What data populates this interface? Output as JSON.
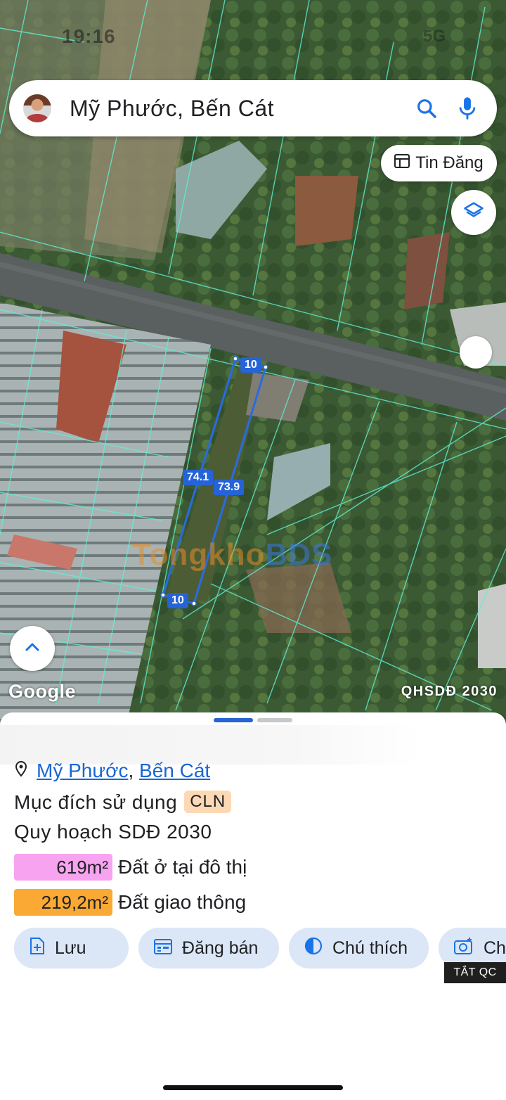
{
  "status_bar": {
    "time": "19:16",
    "right": "5G"
  },
  "search": {
    "query": "Mỹ Phước, Bến Cát"
  },
  "map_controls": {
    "tin_dang_label": "Tin Đăng"
  },
  "map": {
    "google_logo": "Google",
    "layer_label": "QHSDĐ 2030",
    "plot_dimensions": {
      "top": "10",
      "left": "74.1",
      "right": "73.9",
      "bottom": "10"
    },
    "watermark": {
      "part1": "Tongkho",
      "part2": "BDS"
    }
  },
  "details": {
    "location_parts": [
      "Mỹ Phước",
      "Bến Cát"
    ],
    "purpose_label": "Mục đích sử dụng",
    "purpose_code": "CLN",
    "plan_label": "Quy hoạch SDĐ 2030",
    "areas": [
      {
        "value": "619m²",
        "label": "Đất ở tại đô thị",
        "color": "#f7a3f0"
      },
      {
        "value": "219,2m²",
        "label": "Đất giao thông",
        "color": "#f9a934"
      }
    ]
  },
  "actions": [
    {
      "label": "Lưu",
      "icon": "save-icon"
    },
    {
      "label": "Đăng bán",
      "icon": "calendar-icon"
    },
    {
      "label": "Chú thích",
      "icon": "contrast-icon"
    },
    {
      "label": "Ch",
      "icon": "camera-icon"
    }
  ],
  "ad_label": "TẮT QC"
}
